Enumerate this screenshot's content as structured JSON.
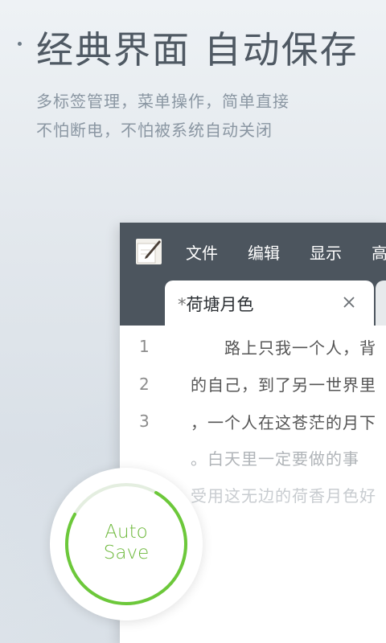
{
  "promo": {
    "headline": "经典界面 自动保存",
    "subtitle_line1": "多标签管理，菜单操作，简单直接",
    "subtitle_line2": "不怕断电，不怕被系统自动关闭"
  },
  "menubar": {
    "items": [
      "文件",
      "编辑",
      "显示",
      "高"
    ]
  },
  "tabs": {
    "active": {
      "modified_marker": "*",
      "title": "荷塘月色"
    }
  },
  "editor": {
    "line_numbers": [
      "1",
      "2",
      "3"
    ],
    "lines": [
      "　　路上只我一个人，背",
      "的自己，到了另一世界里",
      "，一个人在这苍茫的月下",
      "。白天里一定要做的事",
      "受用这无边的荷香月色好"
    ]
  },
  "badge": {
    "line1": "Auto",
    "line2": "Save",
    "progress": 0.75,
    "accent_color": "#6cc83a"
  },
  "icons": [
    "notepad-pen-icon",
    "close-icon"
  ]
}
